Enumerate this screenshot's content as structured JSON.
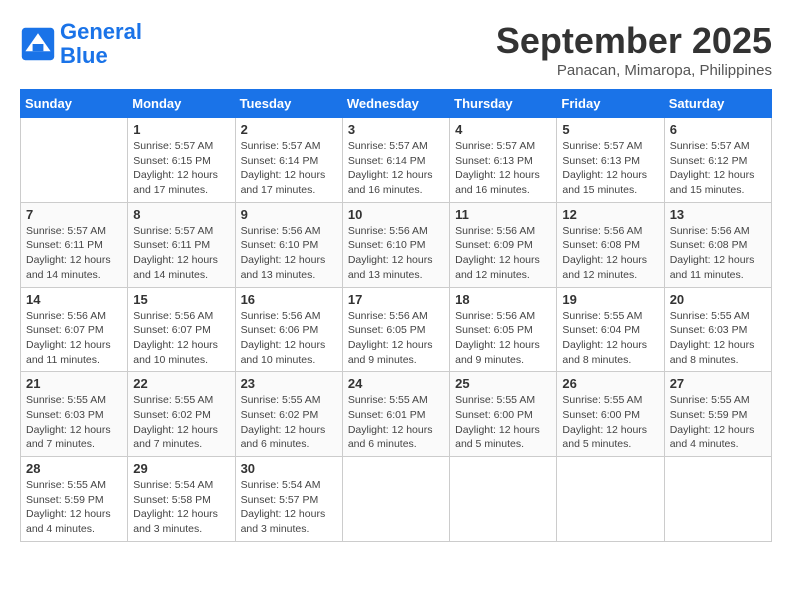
{
  "header": {
    "logo_line1": "General",
    "logo_line2": "Blue",
    "month": "September 2025",
    "location": "Panacan, Mimaropa, Philippines"
  },
  "weekdays": [
    "Sunday",
    "Monday",
    "Tuesday",
    "Wednesday",
    "Thursday",
    "Friday",
    "Saturday"
  ],
  "weeks": [
    [
      {
        "day": "",
        "sunrise": "",
        "sunset": "",
        "daylight": ""
      },
      {
        "day": "1",
        "sunrise": "Sunrise: 5:57 AM",
        "sunset": "Sunset: 6:15 PM",
        "daylight": "Daylight: 12 hours and 17 minutes."
      },
      {
        "day": "2",
        "sunrise": "Sunrise: 5:57 AM",
        "sunset": "Sunset: 6:14 PM",
        "daylight": "Daylight: 12 hours and 17 minutes."
      },
      {
        "day": "3",
        "sunrise": "Sunrise: 5:57 AM",
        "sunset": "Sunset: 6:14 PM",
        "daylight": "Daylight: 12 hours and 16 minutes."
      },
      {
        "day": "4",
        "sunrise": "Sunrise: 5:57 AM",
        "sunset": "Sunset: 6:13 PM",
        "daylight": "Daylight: 12 hours and 16 minutes."
      },
      {
        "day": "5",
        "sunrise": "Sunrise: 5:57 AM",
        "sunset": "Sunset: 6:13 PM",
        "daylight": "Daylight: 12 hours and 15 minutes."
      },
      {
        "day": "6",
        "sunrise": "Sunrise: 5:57 AM",
        "sunset": "Sunset: 6:12 PM",
        "daylight": "Daylight: 12 hours and 15 minutes."
      }
    ],
    [
      {
        "day": "7",
        "sunrise": "Sunrise: 5:57 AM",
        "sunset": "Sunset: 6:11 PM",
        "daylight": "Daylight: 12 hours and 14 minutes."
      },
      {
        "day": "8",
        "sunrise": "Sunrise: 5:57 AM",
        "sunset": "Sunset: 6:11 PM",
        "daylight": "Daylight: 12 hours and 14 minutes."
      },
      {
        "day": "9",
        "sunrise": "Sunrise: 5:56 AM",
        "sunset": "Sunset: 6:10 PM",
        "daylight": "Daylight: 12 hours and 13 minutes."
      },
      {
        "day": "10",
        "sunrise": "Sunrise: 5:56 AM",
        "sunset": "Sunset: 6:10 PM",
        "daylight": "Daylight: 12 hours and 13 minutes."
      },
      {
        "day": "11",
        "sunrise": "Sunrise: 5:56 AM",
        "sunset": "Sunset: 6:09 PM",
        "daylight": "Daylight: 12 hours and 12 minutes."
      },
      {
        "day": "12",
        "sunrise": "Sunrise: 5:56 AM",
        "sunset": "Sunset: 6:08 PM",
        "daylight": "Daylight: 12 hours and 12 minutes."
      },
      {
        "day": "13",
        "sunrise": "Sunrise: 5:56 AM",
        "sunset": "Sunset: 6:08 PM",
        "daylight": "Daylight: 12 hours and 11 minutes."
      }
    ],
    [
      {
        "day": "14",
        "sunrise": "Sunrise: 5:56 AM",
        "sunset": "Sunset: 6:07 PM",
        "daylight": "Daylight: 12 hours and 11 minutes."
      },
      {
        "day": "15",
        "sunrise": "Sunrise: 5:56 AM",
        "sunset": "Sunset: 6:07 PM",
        "daylight": "Daylight: 12 hours and 10 minutes."
      },
      {
        "day": "16",
        "sunrise": "Sunrise: 5:56 AM",
        "sunset": "Sunset: 6:06 PM",
        "daylight": "Daylight: 12 hours and 10 minutes."
      },
      {
        "day": "17",
        "sunrise": "Sunrise: 5:56 AM",
        "sunset": "Sunset: 6:05 PM",
        "daylight": "Daylight: 12 hours and 9 minutes."
      },
      {
        "day": "18",
        "sunrise": "Sunrise: 5:56 AM",
        "sunset": "Sunset: 6:05 PM",
        "daylight": "Daylight: 12 hours and 9 minutes."
      },
      {
        "day": "19",
        "sunrise": "Sunrise: 5:55 AM",
        "sunset": "Sunset: 6:04 PM",
        "daylight": "Daylight: 12 hours and 8 minutes."
      },
      {
        "day": "20",
        "sunrise": "Sunrise: 5:55 AM",
        "sunset": "Sunset: 6:03 PM",
        "daylight": "Daylight: 12 hours and 8 minutes."
      }
    ],
    [
      {
        "day": "21",
        "sunrise": "Sunrise: 5:55 AM",
        "sunset": "Sunset: 6:03 PM",
        "daylight": "Daylight: 12 hours and 7 minutes."
      },
      {
        "day": "22",
        "sunrise": "Sunrise: 5:55 AM",
        "sunset": "Sunset: 6:02 PM",
        "daylight": "Daylight: 12 hours and 7 minutes."
      },
      {
        "day": "23",
        "sunrise": "Sunrise: 5:55 AM",
        "sunset": "Sunset: 6:02 PM",
        "daylight": "Daylight: 12 hours and 6 minutes."
      },
      {
        "day": "24",
        "sunrise": "Sunrise: 5:55 AM",
        "sunset": "Sunset: 6:01 PM",
        "daylight": "Daylight: 12 hours and 6 minutes."
      },
      {
        "day": "25",
        "sunrise": "Sunrise: 5:55 AM",
        "sunset": "Sunset: 6:00 PM",
        "daylight": "Daylight: 12 hours and 5 minutes."
      },
      {
        "day": "26",
        "sunrise": "Sunrise: 5:55 AM",
        "sunset": "Sunset: 6:00 PM",
        "daylight": "Daylight: 12 hours and 5 minutes."
      },
      {
        "day": "27",
        "sunrise": "Sunrise: 5:55 AM",
        "sunset": "Sunset: 5:59 PM",
        "daylight": "Daylight: 12 hours and 4 minutes."
      }
    ],
    [
      {
        "day": "28",
        "sunrise": "Sunrise: 5:55 AM",
        "sunset": "Sunset: 5:59 PM",
        "daylight": "Daylight: 12 hours and 4 minutes."
      },
      {
        "day": "29",
        "sunrise": "Sunrise: 5:54 AM",
        "sunset": "Sunset: 5:58 PM",
        "daylight": "Daylight: 12 hours and 3 minutes."
      },
      {
        "day": "30",
        "sunrise": "Sunrise: 5:54 AM",
        "sunset": "Sunset: 5:57 PM",
        "daylight": "Daylight: 12 hours and 3 minutes."
      },
      {
        "day": "",
        "sunrise": "",
        "sunset": "",
        "daylight": ""
      },
      {
        "day": "",
        "sunrise": "",
        "sunset": "",
        "daylight": ""
      },
      {
        "day": "",
        "sunrise": "",
        "sunset": "",
        "daylight": ""
      },
      {
        "day": "",
        "sunrise": "",
        "sunset": "",
        "daylight": ""
      }
    ]
  ]
}
